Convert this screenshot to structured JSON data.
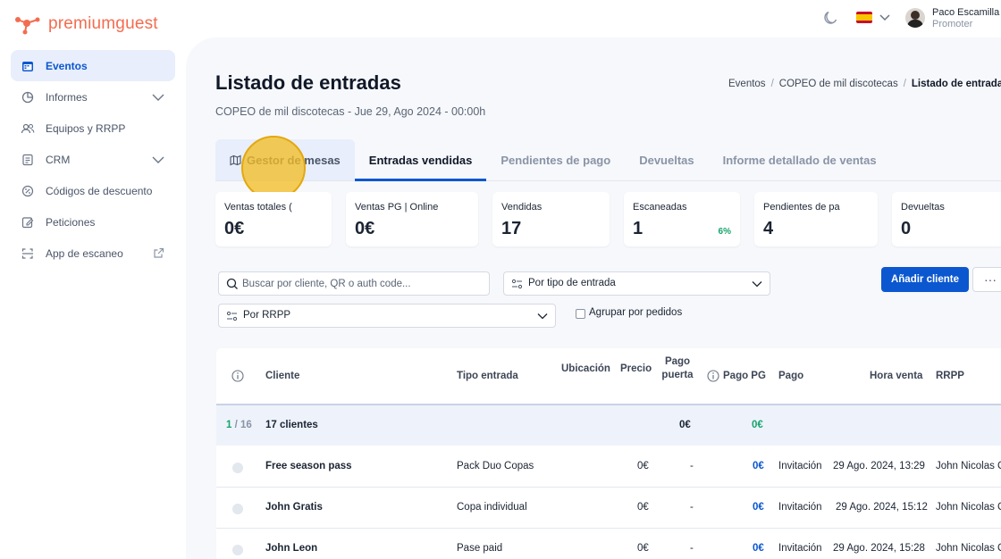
{
  "brand": {
    "name": "premiumguest",
    "accent": "#f36c4f"
  },
  "user": {
    "name": "Paco Escamilla",
    "role": "Promoter"
  },
  "colors": {
    "primary": "#0b57d0",
    "success": "#17a46b",
    "highlight": "#f2be28"
  },
  "sidebar": {
    "items": [
      {
        "label": "Eventos",
        "icon": "calendar-icon",
        "active": true
      },
      {
        "label": "Informes",
        "icon": "pie-chart-icon",
        "expandable": true
      },
      {
        "label": "Equipos y RRPP",
        "icon": "users-icon"
      },
      {
        "label": "CRM",
        "icon": "document-icon",
        "expandable": true
      },
      {
        "label": "Códigos de descuento",
        "icon": "discount-icon"
      },
      {
        "label": "Peticiones",
        "icon": "edit-icon"
      },
      {
        "label": "App de escaneo",
        "icon": "scan-icon",
        "external": true
      }
    ]
  },
  "page": {
    "title": "Listado de entradas",
    "subtitle": "COPEO de mil discotecas - Jue 29, Ago 2024 - 00:00h",
    "breadcrumb": [
      "Eventos",
      "COPEO de mil discotecas",
      "Listado de entradas"
    ]
  },
  "tabs": [
    {
      "label": "Gestor de mesas",
      "icon": "map-icon"
    },
    {
      "label": "Entradas vendidas",
      "active": true
    },
    {
      "label": "Pendientes de pago"
    },
    {
      "label": "Devueltas"
    },
    {
      "label": "Informe detallado de ventas"
    }
  ],
  "stats": [
    {
      "label": "Ventas totales (",
      "value": "0€"
    },
    {
      "label": "Ventas PG | Online",
      "value": "0€"
    },
    {
      "label": "Vendidas",
      "value": "17"
    },
    {
      "label": "Escaneadas",
      "value": "1",
      "percent": "6%"
    },
    {
      "label": "Pendientes de pa",
      "value": "4"
    },
    {
      "label": "Devueltas",
      "value": "0"
    }
  ],
  "filters": {
    "search_placeholder": "Buscar por cliente, QR o auth code...",
    "ticket_type": "Por tipo de entrada",
    "rrpp": "Por RRPP",
    "group_orders": "Agrupar por pedidos",
    "add_client": "Añadir cliente",
    "more": "···"
  },
  "table": {
    "headers": {
      "cliente": "Cliente",
      "tipo": "Tipo entrada",
      "ubicacion": "Ubicación",
      "precio": "Precio",
      "pago_puerta_1": "Pago",
      "pago_puerta_2": "puerta",
      "pago_pg": "Pago PG",
      "pago": "Pago",
      "hora": "Hora venta",
      "rrpp": "RRPP"
    },
    "summary": {
      "page_current": "1",
      "page_total": "/ 16",
      "clients": "17 clientes",
      "total_precio": "0€",
      "total_pg": "0€"
    },
    "rows": [
      {
        "cliente": "Free season pass",
        "tipo": "Pack Duo Copas",
        "precio": "0€",
        "puerta": "-",
        "pago_pg": "0€",
        "pago": "Invitación",
        "hora": "29 Ago. 2024, 13:29",
        "rrpp": "John Nicolas C"
      },
      {
        "cliente": "John Gratis",
        "tipo": "Copa individual",
        "precio": "0€",
        "puerta": "-",
        "pago_pg": "0€",
        "pago": "Invitación",
        "hora": "29 Ago. 2024, 15:12",
        "rrpp": "John Nicolas C"
      },
      {
        "cliente": "John Leon",
        "tipo": "Pase paid",
        "precio": "0€",
        "puerta": "-",
        "pago_pg": "0€",
        "pago": "Invitación",
        "hora": "29 Ago. 2024, 15:28",
        "rrpp": "John Nicolas C"
      }
    ]
  }
}
